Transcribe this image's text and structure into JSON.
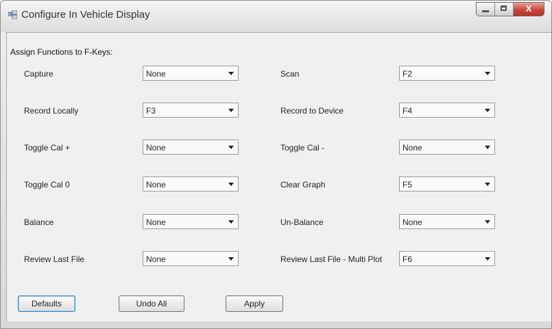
{
  "window": {
    "title": "Configure In Vehicle Display",
    "icon": "window-app-icon",
    "caption": {
      "minimize": "_",
      "maximize": "□",
      "close": "X"
    }
  },
  "group_label": "Assign Functions to F-Keys:",
  "left_column": [
    {
      "label": "Capture",
      "value": "None"
    },
    {
      "label": "Record Locally",
      "value": "F3"
    },
    {
      "label": "Toggle Cal +",
      "value": "None"
    },
    {
      "label": "Toggle Cal 0",
      "value": "None"
    },
    {
      "label": "Balance",
      "value": "None"
    },
    {
      "label": "Review Last File",
      "value": "None"
    }
  ],
  "right_column": [
    {
      "label": "Scan",
      "value": "F2"
    },
    {
      "label": "Record to Device",
      "value": "F4"
    },
    {
      "label": "Toggle Cal -",
      "value": "None"
    },
    {
      "label": "Clear Graph",
      "value": "F5"
    },
    {
      "label": "Un-Balance",
      "value": "None"
    },
    {
      "label": "Review Last File - Multi Plot",
      "value": "F6"
    }
  ],
  "buttons": {
    "defaults": "Defaults",
    "undo_all": "Undo All",
    "apply": "Apply"
  },
  "colors": {
    "close_button": "#c8463a",
    "default_button_border": "#3c7fb1"
  }
}
